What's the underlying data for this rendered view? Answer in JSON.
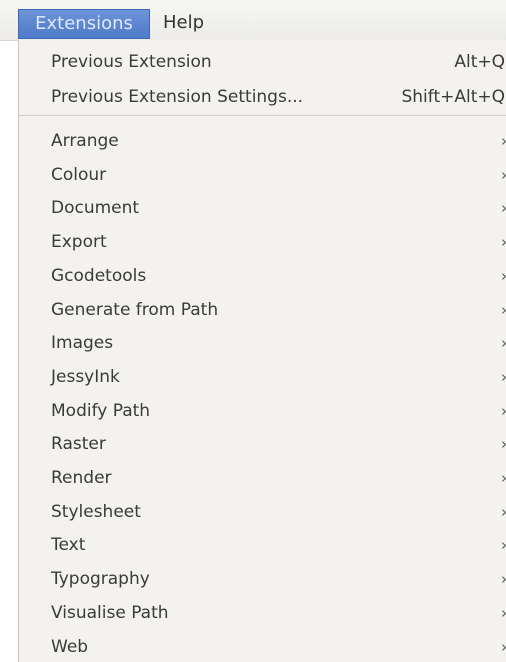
{
  "menubar": {
    "extensions": "Extensions",
    "help": "Help"
  },
  "recent": [
    {
      "label": "Previous Extension",
      "accel": "Alt+Q"
    },
    {
      "label": "Previous Extension Settings...",
      "accel": "Shift+Alt+Q"
    }
  ],
  "submenus": [
    {
      "label": "Arrange"
    },
    {
      "label": "Colour"
    },
    {
      "label": "Document"
    },
    {
      "label": "Export"
    },
    {
      "label": "Gcodetools"
    },
    {
      "label": "Generate from Path"
    },
    {
      "label": "Images"
    },
    {
      "label": "JessyInk"
    },
    {
      "label": "Modify Path"
    },
    {
      "label": "Raster"
    },
    {
      "label": "Render"
    },
    {
      "label": "Stylesheet"
    },
    {
      "label": "Text"
    },
    {
      "label": "Typography"
    },
    {
      "label": "Visualise Path"
    },
    {
      "label": "Web"
    }
  ],
  "submenu_arrow_icon": "chevron-right"
}
